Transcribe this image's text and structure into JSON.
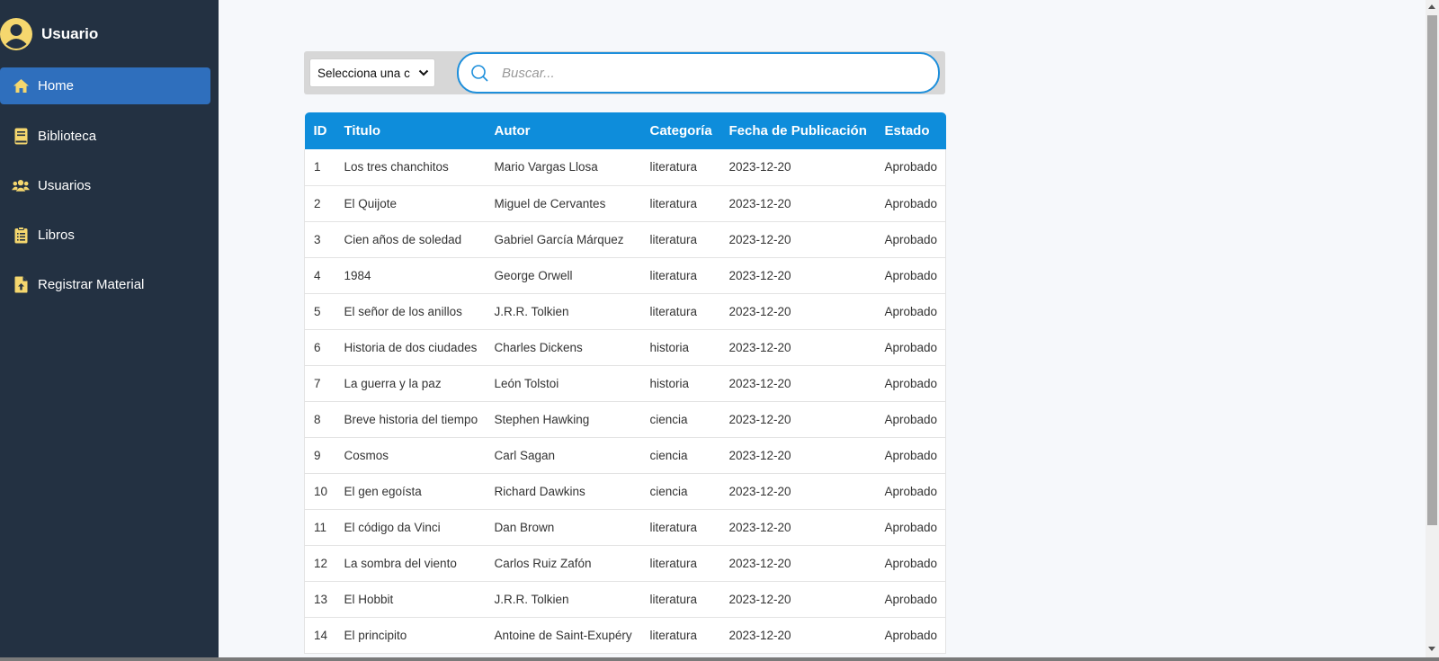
{
  "sidebar": {
    "user_label": "Usuario",
    "items": [
      {
        "label": "Home",
        "icon": "home-icon",
        "active": true
      },
      {
        "label": "Biblioteca",
        "icon": "book-icon",
        "active": false
      },
      {
        "label": "Usuarios",
        "icon": "users-icon",
        "active": false
      },
      {
        "label": "Libros",
        "icon": "clipboard-icon",
        "active": false
      },
      {
        "label": "Registrar Material",
        "icon": "file-upload-icon",
        "active": false
      }
    ]
  },
  "filter": {
    "select_value": "Selecciona una c",
    "search_placeholder": "Buscar..."
  },
  "table": {
    "columns": [
      "ID",
      "Titulo",
      "Autor",
      "Categoría",
      "Fecha de Publicación",
      "Estado"
    ],
    "rows": [
      [
        "1",
        "Los tres chanchitos",
        "Mario Vargas Llosa",
        "literatura",
        "2023-12-20",
        "Aprobado"
      ],
      [
        "2",
        "El Quijote",
        "Miguel de Cervantes",
        "literatura",
        "2023-12-20",
        "Aprobado"
      ],
      [
        "3",
        "Cien años de soledad",
        "Gabriel García Márquez",
        "literatura",
        "2023-12-20",
        "Aprobado"
      ],
      [
        "4",
        "1984",
        "George Orwell",
        "literatura",
        "2023-12-20",
        "Aprobado"
      ],
      [
        "5",
        "El señor de los anillos",
        "J.R.R. Tolkien",
        "literatura",
        "2023-12-20",
        "Aprobado"
      ],
      [
        "6",
        "Historia de dos ciudades",
        "Charles Dickens",
        "historia",
        "2023-12-20",
        "Aprobado"
      ],
      [
        "7",
        "La guerra y la paz",
        "León Tolstoi",
        "historia",
        "2023-12-20",
        "Aprobado"
      ],
      [
        "8",
        "Breve historia del tiempo",
        "Stephen Hawking",
        "ciencia",
        "2023-12-20",
        "Aprobado"
      ],
      [
        "9",
        "Cosmos",
        "Carl Sagan",
        "ciencia",
        "2023-12-20",
        "Aprobado"
      ],
      [
        "10",
        "El gen egoísta",
        "Richard Dawkins",
        "ciencia",
        "2023-12-20",
        "Aprobado"
      ],
      [
        "11",
        "El código da Vinci",
        "Dan Brown",
        "literatura",
        "2023-12-20",
        "Aprobado"
      ],
      [
        "12",
        "La sombra del viento",
        "Carlos Ruiz Zafón",
        "literatura",
        "2023-12-20",
        "Aprobado"
      ],
      [
        "13",
        "El Hobbit",
        "J.R.R. Tolkien",
        "literatura",
        "2023-12-20",
        "Aprobado"
      ],
      [
        "14",
        "El principito",
        "Antoine de Saint-Exupéry",
        "literatura",
        "2023-12-20",
        "Aprobado"
      ]
    ]
  },
  "colors": {
    "sidebar_bg": "#233142",
    "active_item": "#2f6fbd",
    "table_header": "#0e8ddb",
    "icon_yellow": "#f5d76e"
  }
}
